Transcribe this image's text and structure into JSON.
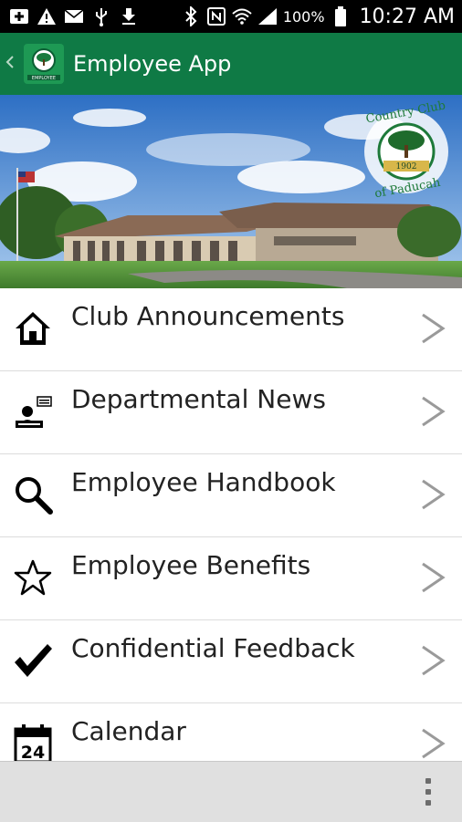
{
  "status_bar": {
    "battery_percent": "100%",
    "time": "10:27 AM",
    "icons": [
      "add-box-icon",
      "warning-icon",
      "mail-icon",
      "usb-icon",
      "download-icon",
      "bluetooth-icon",
      "nfc-icon",
      "wifi-icon",
      "signal-icon",
      "battery-icon"
    ]
  },
  "app_bar": {
    "title": "Employee App",
    "logo_caption": "EMPLOYEE"
  },
  "banner": {
    "seal_top_text": "Country Club",
    "seal_bottom_text": "of Paducah",
    "seal_year": "1902"
  },
  "menu": {
    "items": [
      {
        "label": "Club Announcements",
        "icon": "house-icon"
      },
      {
        "label": "Departmental News",
        "icon": "news-presenter-icon"
      },
      {
        "label": "Employee Handbook",
        "icon": "magnifier-icon"
      },
      {
        "label": "Employee Benefits",
        "icon": "star-icon"
      },
      {
        "label": "Confidential Feedback",
        "icon": "checkmark-icon"
      },
      {
        "label": "Calendar",
        "icon": "calendar-icon",
        "calendar_day": "24"
      }
    ]
  },
  "colors": {
    "app_bar": "#0f7a45",
    "status_bar": "#000000",
    "bottom_bar": "#e0e0e0"
  }
}
